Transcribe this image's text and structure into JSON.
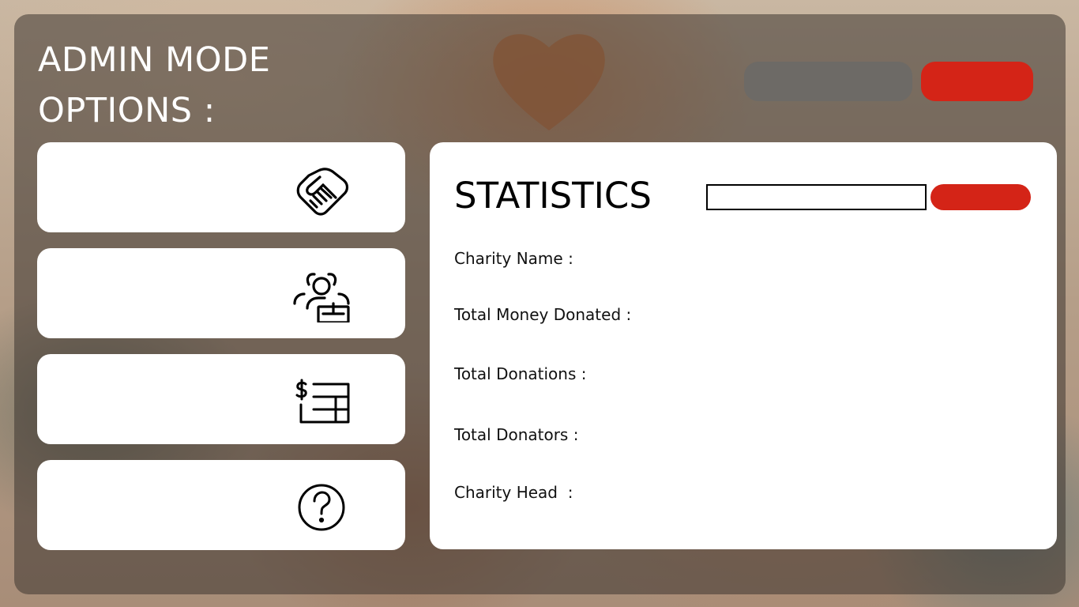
{
  "header": {
    "title": "ADMIN MODE OPTIONS :",
    "grey_button_label": "",
    "red_button_label": ""
  },
  "nav": {
    "items": [
      {
        "label": "",
        "icon": "handshake-icon"
      },
      {
        "label": "",
        "icon": "charity-users-icon"
      },
      {
        "label": "",
        "icon": "dollar-table-icon"
      },
      {
        "label": "",
        "icon": "question-icon"
      }
    ]
  },
  "statistics": {
    "title": "STATISTICS",
    "search_value": "",
    "search_placeholder": "",
    "search_button_label": "",
    "fields": [
      {
        "label": "Charity Name :",
        "value": ""
      },
      {
        "label": "Total Money Donated :",
        "value": ""
      },
      {
        "label": "Total Donations :",
        "value": ""
      },
      {
        "label": "Total Donators :",
        "value": ""
      },
      {
        "label": "Charity Head  :",
        "value": ""
      }
    ]
  },
  "colors": {
    "accent_red": "#d42417",
    "button_grey": "#6d6a66",
    "overlay": "#3c3430",
    "panel": "#ffffff"
  }
}
